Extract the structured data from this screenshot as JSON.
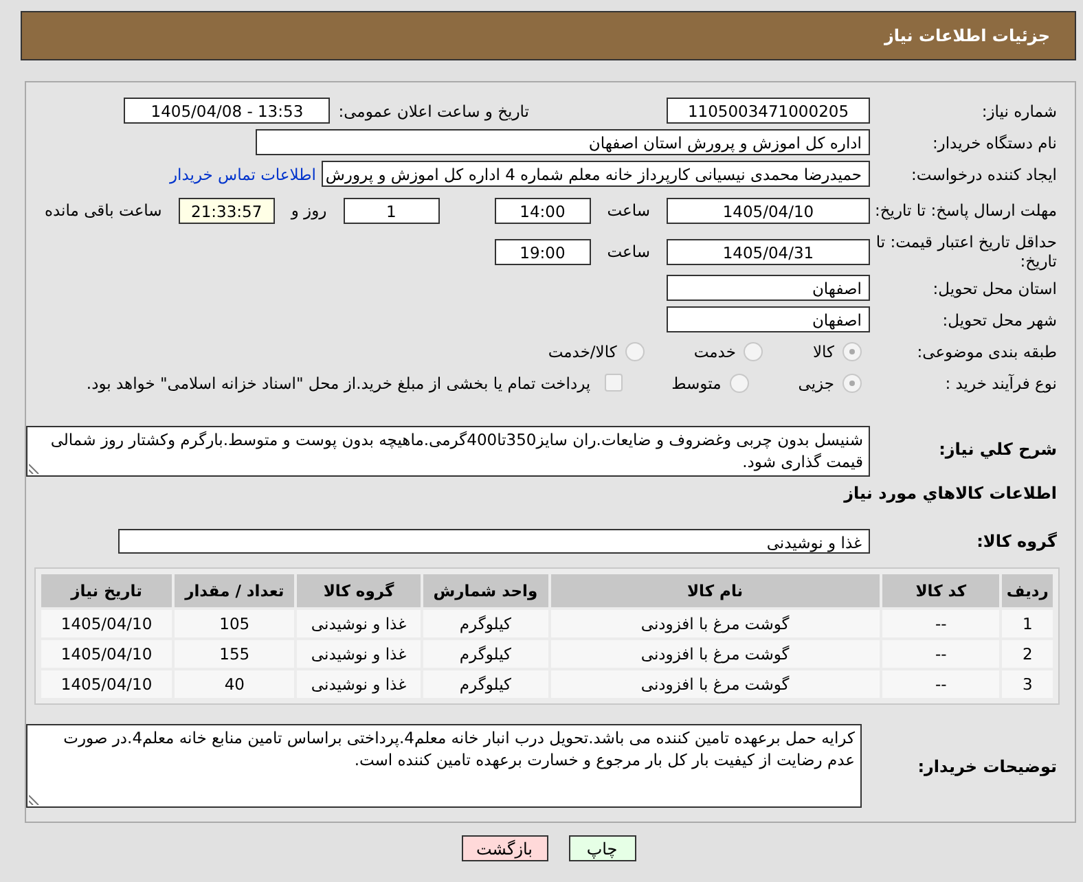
{
  "header": {
    "title": "جزئیات اطلاعات نیاز"
  },
  "need_number": {
    "label": "شماره نیاز:",
    "value": "1105003471000205"
  },
  "announce": {
    "label": "تاریخ و ساعت اعلان عمومی:",
    "value": "1405/04/08 - 13:53"
  },
  "buyer_org": {
    "label": "نام دستگاه خریدار:",
    "value": "اداره کل اموزش و پرورش استان اصفهان"
  },
  "requester": {
    "label": "ایجاد کننده درخواست:",
    "value": "حمیدرضا محمدی نیسیانی کارپرداز خانه معلم شماره 4 اداره کل اموزش و پرورش",
    "link": "اطلاعات تماس خریدار"
  },
  "response_deadline": {
    "label": "مهلت ارسال پاسخ: تا تاریخ:",
    "date": "1405/04/10",
    "time_label": "ساعت",
    "time": "14:00",
    "days": "1",
    "days_label": "روز و",
    "remaining": "21:33:57",
    "remaining_label": "ساعت باقی مانده"
  },
  "price_validity": {
    "label": "حداقل تاریخ اعتبار قیمت: تا تاریخ:",
    "date": "1405/04/31",
    "time_label": "ساعت",
    "time": "19:00"
  },
  "province": {
    "label": "استان محل تحویل:",
    "value": "اصفهان"
  },
  "city": {
    "label": "شهر محل تحویل:",
    "value": "اصفهان"
  },
  "category": {
    "label": "طبقه بندی موضوعی:",
    "options": [
      {
        "label": "کالا",
        "selected": true
      },
      {
        "label": "خدمت",
        "selected": false
      },
      {
        "label": "کالا/خدمت",
        "selected": false
      }
    ]
  },
  "purchase_process": {
    "label": "نوع فرآیند خرید :",
    "options": [
      {
        "label": "جزیی",
        "selected": true
      },
      {
        "label": "متوسط",
        "selected": false
      }
    ],
    "payment": {
      "label": "پرداخت تمام یا بخشی از مبلغ خرید.از محل \"اسناد خزانه اسلامی\" خواهد بود.",
      "checked": false
    }
  },
  "description": {
    "label": "شرح کلي نياز:",
    "value": "شنیسل بدون چربی وغضروف و ضایعات.ران سایز350تا400گرمی.ماهیچه بدون پوست و متوسط.بارگرم وکشتار روز شمالی قیمت گذاری شود."
  },
  "goods_title": "اطلاعات کالاهاي مورد نياز",
  "goods_group": {
    "label": "گروه کالا:",
    "value": "غذا و نوشیدنی"
  },
  "table": {
    "columns": [
      "ردیف",
      "کد کالا",
      "نام کالا",
      "واحد شمارش",
      "گروه کالا",
      "تعداد / مقدار",
      "تاریخ نیاز"
    ],
    "rows": [
      [
        "1",
        "--",
        "گوشت مرغ با افزودنی",
        "کیلوگرم",
        "غذا و نوشیدنی",
        "105",
        "1405/04/10"
      ],
      [
        "2",
        "--",
        "گوشت مرغ با افزودنی",
        "کیلوگرم",
        "غذا و نوشیدنی",
        "155",
        "1405/04/10"
      ],
      [
        "3",
        "--",
        "گوشت مرغ با افزودنی",
        "کیلوگرم",
        "غذا و نوشیدنی",
        "40",
        "1405/04/10"
      ]
    ]
  },
  "buyer_notes": {
    "label": "توضیحات خریدار:",
    "value": "کرایه حمل برعهده تامین کننده می باشد.تحویل درب انبار خانه معلم4.پرداختی براساس تامین منابع خانه معلم4.در صورت عدم رضایت از کیفیت بار کل بار مرجوع و خسارت برعهده تامین کننده است."
  },
  "buttons": [
    {
      "label": "چاپ",
      "kind": "print"
    },
    {
      "label": "بازگشت",
      "kind": "back"
    }
  ]
}
